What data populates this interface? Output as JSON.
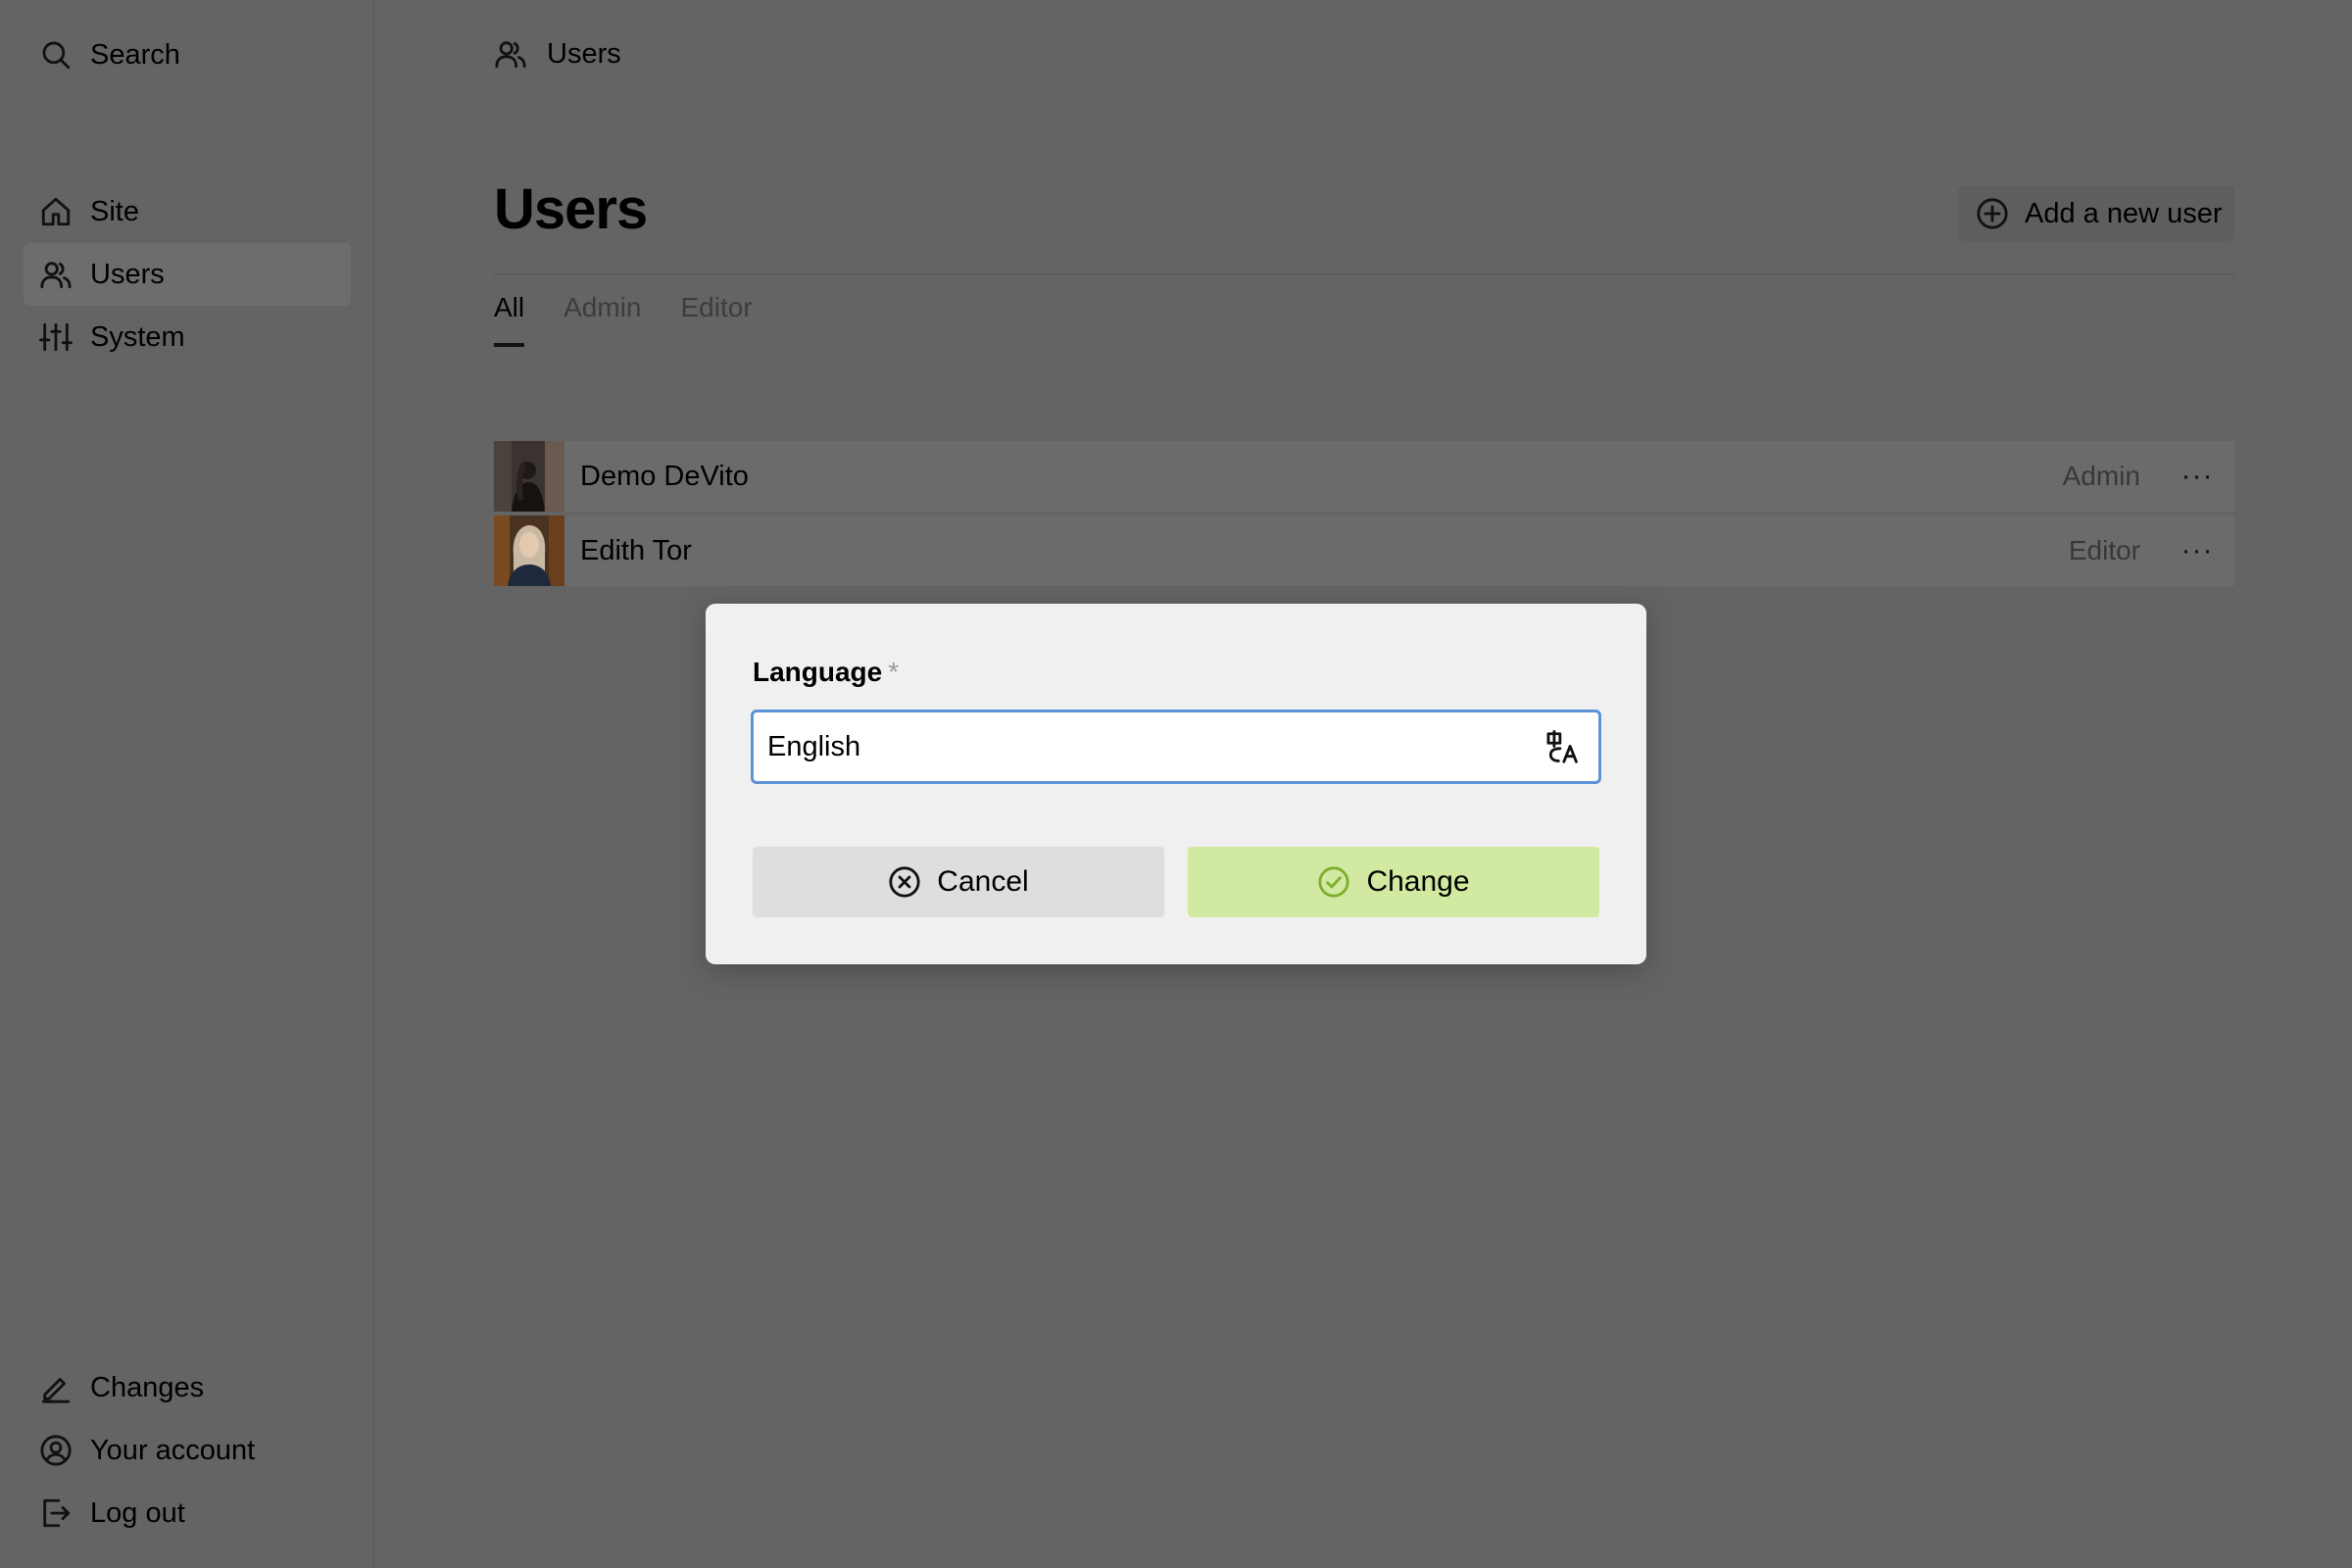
{
  "sidebar": {
    "search_label": "Search",
    "items": [
      {
        "label": "Site",
        "icon": "home-icon"
      },
      {
        "label": "Users",
        "icon": "users-icon",
        "active": true
      },
      {
        "label": "System",
        "icon": "sliders-icon"
      }
    ],
    "bottom_items": [
      {
        "label": "Changes",
        "icon": "pencil-icon"
      },
      {
        "label": "Your account",
        "icon": "user-circle-icon"
      },
      {
        "label": "Log out",
        "icon": "logout-icon"
      }
    ]
  },
  "breadcrumb": {
    "label": "Users",
    "icon": "users-icon"
  },
  "page": {
    "title": "Users",
    "add_user_label": "Add a new user"
  },
  "tabs": [
    {
      "label": "All",
      "active": true
    },
    {
      "label": "Admin"
    },
    {
      "label": "Editor"
    }
  ],
  "users": [
    {
      "name": "Demo DeVito",
      "role": "Admin"
    },
    {
      "name": "Edith Tor",
      "role": "Editor"
    }
  ],
  "dialog": {
    "field_label": "Language",
    "required_mark": "*",
    "value": "English",
    "cancel_label": "Cancel",
    "submit_label": "Change"
  },
  "colors": {
    "overlay": "#646464",
    "accent": "#5c93d8",
    "submit_bg": "#d2e9a1",
    "submit_icon": "#7fae2c"
  }
}
